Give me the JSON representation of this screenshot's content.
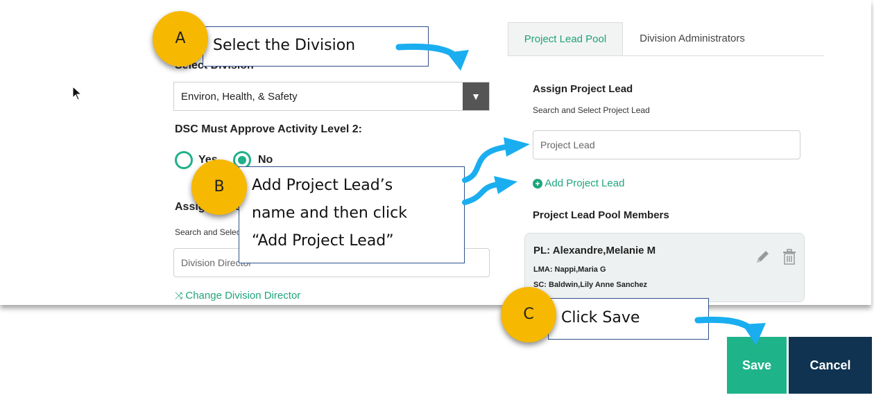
{
  "left": {
    "select_division_label": "Select Division",
    "division_value": "Environ, Health, & Safety",
    "dsc_label": "DSC Must Approve Activity Level 2:",
    "radio_yes_label": "Yes",
    "radio_no_label": "No",
    "assign_label": "Assign Division Director",
    "search_label": "Search and Select Division Director",
    "director_placeholder": "Division Director",
    "change_director_label": "Change Division Director"
  },
  "right": {
    "tabs": [
      {
        "label": "Project Lead Pool"
      },
      {
        "label": "Division Administrators"
      }
    ],
    "assign_label": "Assign Project Lead",
    "search_label": "Search and Select Project Lead",
    "lead_placeholder": "Project Lead",
    "add_lead_label": "Add Project Lead",
    "pool_members_label": "Project Lead Pool Members",
    "member": {
      "pl": "PL: Alexandre,Melanie M",
      "lma": "LMA: Nappi,Maria G",
      "sc": "SC: Baldwin,Lily Anne Sanchez"
    }
  },
  "buttons": {
    "save_label": "Save",
    "cancel_label": "Cancel"
  },
  "callouts": {
    "a": {
      "badge": "A",
      "text": "Select the Division"
    },
    "b": {
      "badge": "B",
      "line1": "Add Project Lead’s",
      "line2": "name and then click",
      "line3": "“Add Project Lead”"
    },
    "c": {
      "badge": "C",
      "text": "Click Save"
    }
  },
  "colors": {
    "accent": "#20b08a",
    "save_bg": "#1fb38a",
    "cancel_bg": "#0f3350",
    "badge": "#f6b800",
    "arrow": "#1aaef0"
  }
}
